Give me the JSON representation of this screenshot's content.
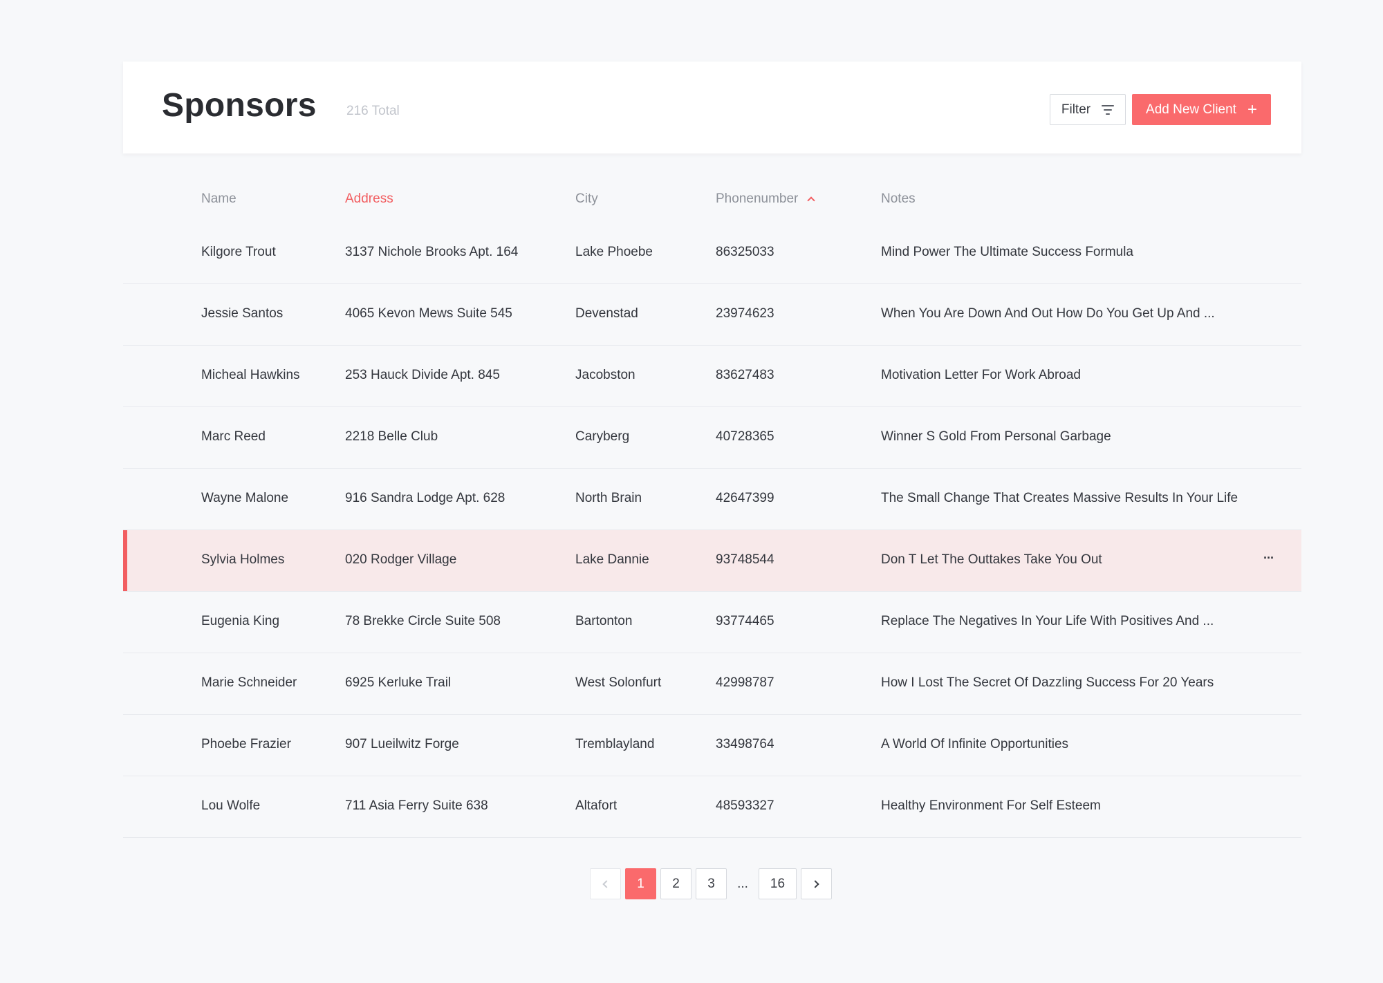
{
  "header": {
    "title": "Sponsors",
    "total": "216 Total",
    "filter_label": "Filter",
    "add_label": "Add New Client",
    "add_icon": "+"
  },
  "colors": {
    "accent": "#fa6a6c",
    "selected_row_bg": "#f8e9ea",
    "background": "#f7f8fa"
  },
  "table": {
    "columns": {
      "name": "Name",
      "address": "Address",
      "city": "City",
      "phone": "Phonenumber",
      "notes": "Notes"
    },
    "active_column": "address",
    "sorted_column": "phone",
    "sort_direction": "ascending",
    "selected_row": 5,
    "rows": [
      {
        "name": "Kilgore Trout",
        "address": "3137 Nichole Brooks Apt. 164",
        "city": "Lake Phoebe",
        "phone": "86325033",
        "notes": "Mind Power The Ultimate Success Formula"
      },
      {
        "name": "Jessie Santos",
        "address": "4065 Kevon Mews Suite 545",
        "city": "Devenstad",
        "phone": "23974623",
        "notes": "When You Are Down And Out How Do You Get Up And ..."
      },
      {
        "name": "Micheal Hawkins",
        "address": "253 Hauck Divide Apt. 845",
        "city": "Jacobston",
        "phone": "83627483",
        "notes": "Motivation Letter For Work Abroad"
      },
      {
        "name": "Marc Reed",
        "address": "2218 Belle Club",
        "city": "Caryberg",
        "phone": "40728365",
        "notes": "Winner S Gold From Personal Garbage"
      },
      {
        "name": "Wayne Malone",
        "address": "916 Sandra Lodge Apt. 628",
        "city": "North Brain",
        "phone": "42647399",
        "notes": "The Small Change That Creates Massive Results In Your Life"
      },
      {
        "name": "Sylvia Holmes",
        "address": "020 Rodger Village",
        "city": "Lake Dannie",
        "phone": "93748544",
        "notes": "Don T Let The Outtakes Take You Out"
      },
      {
        "name": "Eugenia King",
        "address": "78 Brekke Circle Suite 508",
        "city": "Bartonton",
        "phone": "93774465",
        "notes": "Replace The Negatives In Your Life With Positives And ..."
      },
      {
        "name": "Marie Schneider",
        "address": "6925 Kerluke Trail",
        "city": "West Solonfurt",
        "phone": "42998787",
        "notes": "How I Lost The Secret Of Dazzling Success For 20 Years"
      },
      {
        "name": "Phoebe Frazier",
        "address": "907 Lueilwitz Forge",
        "city": "Tremblayland",
        "phone": "33498764",
        "notes": "A World Of Infinite Opportunities"
      },
      {
        "name": "Lou Wolfe",
        "address": "711 Asia Ferry Suite 638",
        "city": "Altafort",
        "phone": "48593327",
        "notes": "Healthy Environment For Self Esteem"
      }
    ],
    "row_menu_icon": "···"
  },
  "pagination": {
    "pages": [
      "1",
      "2",
      "3"
    ],
    "ellipsis": "...",
    "last_page": "16",
    "current": "1"
  }
}
